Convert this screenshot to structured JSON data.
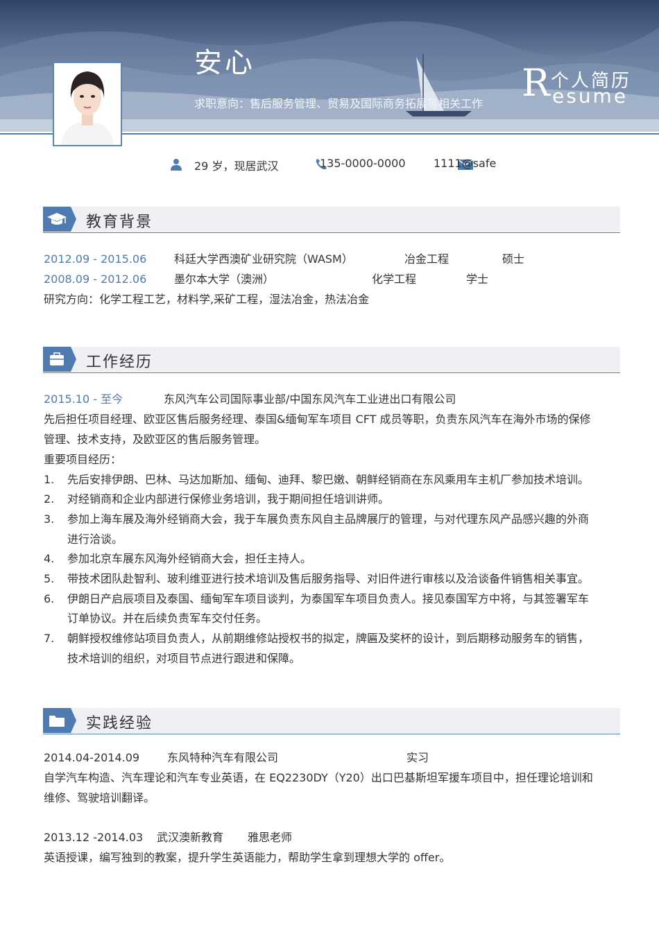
{
  "header": {
    "name": "安心",
    "intent": "求职意向：售后服务管理、贸易及国际商务拓展等相关工作",
    "logo_cn": "个人简历",
    "logo_R": "R",
    "logo_en": "esume"
  },
  "contact": {
    "age_location": "29 岁，现居武汉",
    "phone": "135-0000-0000",
    "email": "1111@safe"
  },
  "education": {
    "title": "教育背景",
    "rows": [
      {
        "period": "2012.09 - 2015.06",
        "school": "科廷大学西澳矿业研究院（WASM）",
        "major": "冶金工程",
        "degree": "硕士"
      },
      {
        "period": "2008.09 - 2012.06",
        "school": "墨尔本大学（澳洲）",
        "major": "化学工程",
        "degree": "学士"
      }
    ],
    "research": "研究方向：化学工程工艺，材料学,采矿工程，湿法冶金，热法冶金"
  },
  "work": {
    "title": "工作经历",
    "period": "2015.10 - 至今",
    "company": "东风汽车公司国际事业部/中国东风汽车工业进出口有限公司",
    "summary_1": "先后担任项目经理、欧亚区售后服务经理、泰国&缅甸军车项目 CFT 成员等职，负责东风汽车在海外市场的保修",
    "summary_2": "管理、技术支持，及欧亚区的售后服务管理。",
    "projects_label": "重要项目经历：",
    "items": [
      {
        "num": "1.",
        "l1": "先后安排伊朗、巴林、马达加斯加、缅甸、迪拜、黎巴嫩、朝鲜经销商在东风乘用车主机厂参加技术培训。",
        "l2": ""
      },
      {
        "num": "2.",
        "l1": "对经销商和企业内部进行保修业务培训，我于期间担任培训讲师。",
        "l2": ""
      },
      {
        "num": "3.",
        "l1": "参加上海车展及海外经销商大会，我于车展负责东风自主品牌展厅的管理，与对代理东风产品感兴趣的外商",
        "l2": "进行洽谈。"
      },
      {
        "num": "4.",
        "l1": "参加北京车展东风海外经销商大会，担任主持人。",
        "l2": ""
      },
      {
        "num": "5.",
        "l1": "带技术团队赴智利、玻利维亚进行技术培训及售后服务指导、对旧件进行审核以及洽谈备件销售相关事宜。",
        "l2": ""
      },
      {
        "num": "6.",
        "l1": "伊朗日产启辰项目及泰国、缅甸军车项目谈判，为泰国军车项目负责人。接见泰国军方中将，与其签署军车",
        "l2": "订单协议。并在后续负责军车交付任务。"
      },
      {
        "num": "7.",
        "l1": "朝鲜授权维修站项目负责人，从前期维修站授权书的拟定，牌匾及奖杯的设计，到后期移动服务车的销售，",
        "l2": "技术培训的组织，对项目节点进行跟进和保障。"
      }
    ]
  },
  "practice": {
    "title": "实践经验",
    "exp1": {
      "period": "2014.04-2014.09",
      "org": "东风特种汽车有限公司",
      "role": "实习",
      "desc_1": "自学汽车构造、汽车理论和汽车专业英语，在 EQ2230DY（Y20）出口巴基斯坦军援车项目中，担任理论培训和",
      "desc_2": "维修、驾驶培训翻译。"
    },
    "exp2": {
      "period": "2013.12 -2014.03",
      "org": "武汉澳新教育",
      "role": "雅思老师",
      "desc_1": "英语授课，编写独到的教案，提升学生英语能力，帮助学生拿到理想大学的 offer。"
    }
  },
  "colors": {
    "accent": "#4f7bb0",
    "banner_dark": "#2f4467",
    "banner_light": "#b9c6d7"
  }
}
